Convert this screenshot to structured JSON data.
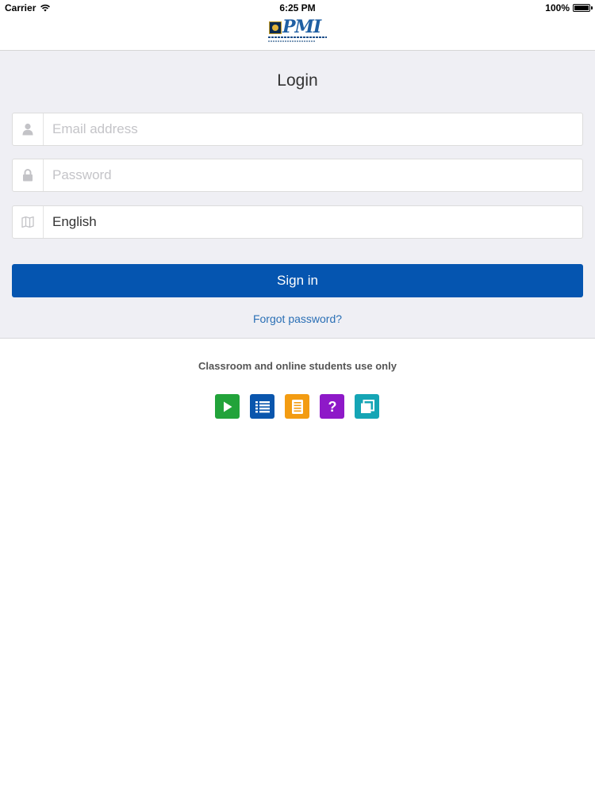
{
  "status_bar": {
    "carrier": "Carrier",
    "time": "6:25 PM",
    "battery": "100%",
    "battery_level": 1.0
  },
  "login": {
    "title": "Login",
    "email_placeholder": "Email address",
    "password_placeholder": "Password",
    "language_value": "English",
    "sign_in_label": "Sign in",
    "forgot_label": "Forgot password?"
  },
  "footer": {
    "note": "Classroom and online students use only",
    "apps": [
      {
        "icon": "play-icon",
        "color": "#22a33a"
      },
      {
        "icon": "list-icon",
        "color": "#0a56ad"
      },
      {
        "icon": "book-icon",
        "color": "#f39c12"
      },
      {
        "icon": "question-icon",
        "color": "#8e19c8"
      },
      {
        "icon": "copy-icon",
        "color": "#15a5b5"
      }
    ]
  },
  "colors": {
    "primary": "#0555b0",
    "link": "#2a6fb5",
    "panel_bg": "#efeff4"
  }
}
